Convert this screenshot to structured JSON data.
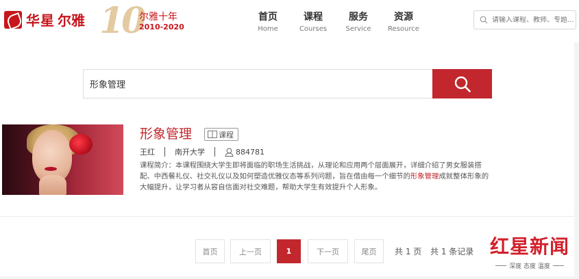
{
  "brand": {
    "logo_text": "华星",
    "brand_name": "尔雅",
    "anniversary_number": "10",
    "anniversary_title": "尔雅十年",
    "anniversary_years": "2010-2020"
  },
  "nav": [
    {
      "cn": "首页",
      "en": "Home"
    },
    {
      "cn": "课程",
      "en": "Courses"
    },
    {
      "cn": "服务",
      "en": "Service"
    },
    {
      "cn": "资源",
      "en": "Resource"
    }
  ],
  "top_search": {
    "placeholder": "请输入课程、教师、专题..."
  },
  "main_search": {
    "value": "形象管理"
  },
  "result": {
    "title": "形象管理",
    "tag": "课程",
    "teacher": "王红",
    "school": "南开大学",
    "learners": "884781",
    "desc_before": "课程简介：本课程围绕大学生即将面临的职场生活挑战，从理论和应用两个层面展开，详细介绍了男女服装搭配、中西餐礼仪、社交礼仪以及如何塑造优雅仪态等系列问题，旨在借由每一个细节的",
    "desc_highlight": "形象管理",
    "desc_after": "成就整体形象的大幅提升，让学习者从容自信面对社交难题，帮助大学生有效提升个人形象。"
  },
  "pagination": {
    "first": "首页",
    "prev": "上一页",
    "current": "1",
    "next": "下一页",
    "last": "尾页",
    "pages_info": "共 1 页",
    "records_info": "共 1 条记录"
  },
  "watermark": {
    "title": "红星新闻",
    "subtitle": "深度 态度 温度"
  },
  "colors": {
    "accent": "#c1272d",
    "brand": "#c8161d"
  }
}
